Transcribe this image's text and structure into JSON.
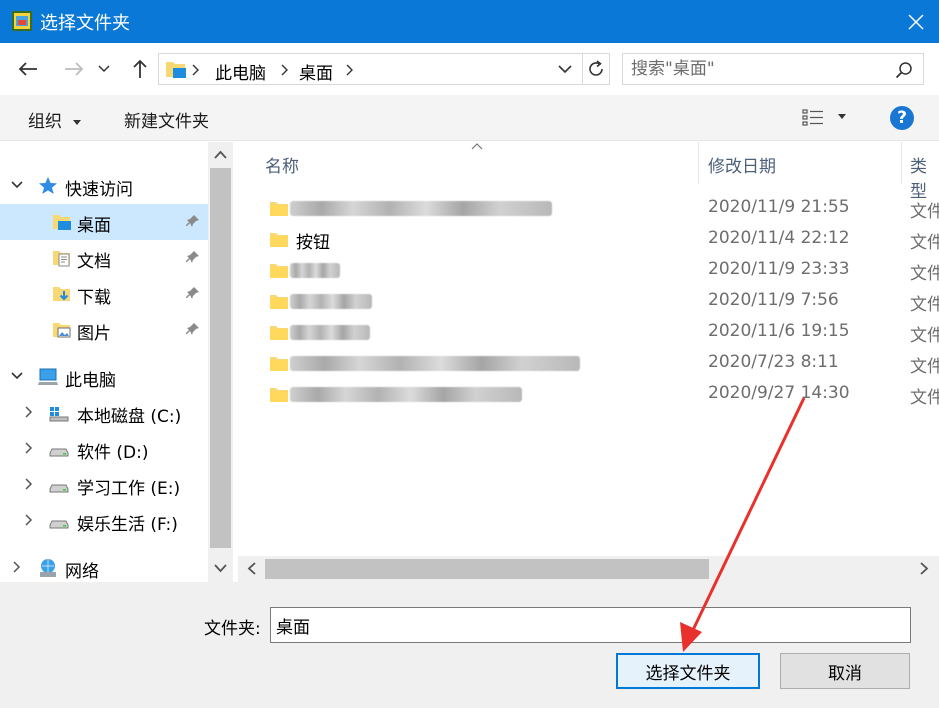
{
  "window": {
    "title": "选择文件夹",
    "close_icon": "close-icon"
  },
  "address_bar": {
    "crumbs": [
      "此电脑",
      "桌面"
    ],
    "search_placeholder": "搜索\"桌面\""
  },
  "toolbar": {
    "organize_label": "组织",
    "new_folder_label": "新建文件夹",
    "help_label": "?"
  },
  "nav": {
    "quick_access": "快速访问",
    "desktop": "桌面",
    "documents": "文档",
    "downloads": "下载",
    "pictures": "图片",
    "this_pc": "此电脑",
    "drive_c": "本地磁盘 (C:)",
    "drive_d": "软件 (D:)",
    "drive_e": "学习工作 (E:)",
    "drive_f": "娱乐生活 (F:)",
    "network": "网络"
  },
  "file_list": {
    "columns": {
      "name": "名称",
      "modified": "修改日期",
      "type": "类型"
    },
    "rows": [
      {
        "name": "",
        "date": "2020/11/9 21:55",
        "type": "文件"
      },
      {
        "name": "按钮",
        "date": "2020/11/4 22:12",
        "type": "文件"
      },
      {
        "name": "",
        "date": "2020/11/9 23:33",
        "type": "文件"
      },
      {
        "name": "",
        "date": "2020/11/9 7:56",
        "type": "文件"
      },
      {
        "name": "",
        "date": "2020/11/6 19:15",
        "type": "文件"
      },
      {
        "name": "",
        "date": "2020/7/23 8:11",
        "type": "文件"
      },
      {
        "name": "",
        "date": "2020/9/27 14:30",
        "type": "文件"
      }
    ]
  },
  "bottom": {
    "folder_label": "文件夹:",
    "folder_value": "桌面",
    "select_button": "选择文件夹",
    "cancel_button": "取消"
  },
  "colors": {
    "titlebar": "#0a78d7",
    "selection": "#cce8ff",
    "annotation": "#e8312d"
  }
}
